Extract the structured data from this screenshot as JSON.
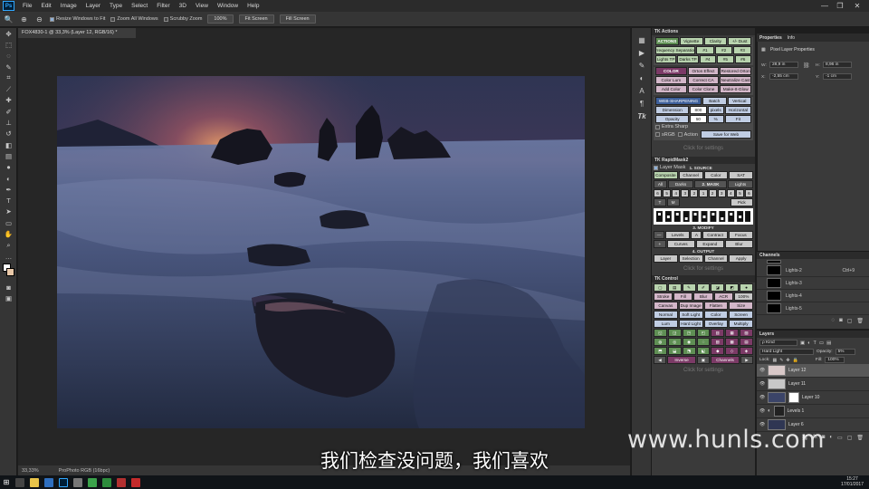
{
  "menubar": {
    "logo": "Ps",
    "items": [
      "File",
      "Edit",
      "Image",
      "Layer",
      "Type",
      "Select",
      "Filter",
      "3D",
      "View",
      "Window",
      "Help"
    ],
    "controls": [
      "—",
      "❐",
      "✕"
    ]
  },
  "options": {
    "resize_windows_label": "Resize Windows to Fit",
    "zoom_all_label": "Zoom All Windows",
    "scrubby_label": "Scrubby Zoom",
    "zoom_value": "100%",
    "fit_screen": "Fit Screen",
    "fill_screen": "Fill Screen"
  },
  "document": {
    "tab_title": "FOX4830-1 @ 33,3% (Layer 12, RGB/16) *",
    "status_zoom": "33,33%",
    "status_profile": "ProPhoto RGB (16bpc)"
  },
  "tk_actions": {
    "title": "TK Actions",
    "actions_row1": [
      "ACTIONS",
      "Vignette",
      "Clarity",
      "+/- Dust"
    ],
    "actions_row2": [
      "Frequency Separation",
      "#1",
      "#2",
      "#3"
    ],
    "actions_row3": [
      "Lights TP",
      "Darks TP",
      "#4",
      "#5",
      "#6"
    ],
    "color_row1": [
      "COLOR",
      "Orton Effect",
      "Restored Orton"
    ],
    "color_row2": [
      "Color Lum",
      "Correct CA",
      "Neutralize Cast"
    ],
    "color_row3": [
      "Add Color",
      "Color Clone",
      "Make-It-Glow"
    ],
    "web_row1": [
      "WEB-SHARPENING",
      "Batch",
      "Vertical"
    ],
    "dimension_label": "Dimension",
    "dimension_value": "800",
    "pixels_label": "pixels",
    "horizontal_label": "Horizontal",
    "opacity_label": "Opacity",
    "opacity_value": "50",
    "percent_label": "%",
    "fit_label": "Fit",
    "extra_sharp_label": "Extra Sharp",
    "srgb_label": "sRGB",
    "action_label": "Action",
    "save_web_label": "Save for Web",
    "click_settings": "Click for settings"
  },
  "tk_rapidmask": {
    "title": "TK RapidMask2",
    "layer_mask": "Layer Mask",
    "source_label": "1. SOURCE",
    "source_buttons": [
      "Composite",
      "Channel",
      "Color",
      "SAT"
    ],
    "mask_row": [
      "All",
      "Darks",
      "2. MASK",
      "Lights"
    ],
    "zones": [
      "6",
      "5",
      "4",
      "3",
      "2",
      "1",
      "2",
      "3",
      "4",
      "5",
      "6"
    ],
    "tm_row": [
      "T",
      "M",
      "Pick"
    ],
    "modify_label": "3. MODIFY",
    "modify_row1": [
      "Levels",
      "A",
      "Contract",
      "Focus"
    ],
    "modify_row2": [
      "Curves",
      "Expand",
      "Blur"
    ],
    "output_label": "4. OUTPUT",
    "output_row": [
      "Layer",
      "Selection",
      "Channel",
      "Apply"
    ],
    "click_settings": "Click for settings"
  },
  "tk_control": {
    "title": "TK Control",
    "row_stroke": [
      "Stroke",
      "Fill",
      "Blur",
      "ACR",
      "100%"
    ],
    "row_canvas": [
      "Canvas",
      "Dup Image",
      "Flatten",
      "Size"
    ],
    "row_blend": [
      "Normal",
      "Soft Light",
      "Color",
      "Screen"
    ],
    "row_lum": [
      "Lum",
      "Hard Light",
      "Overlay",
      "Multiply"
    ],
    "row_inverse": [
      "Inverse",
      "Channels"
    ],
    "click_settings": "Click for settings"
  },
  "properties": {
    "tab1": "Properties",
    "tab2": "Info",
    "subtitle": "Pixel Layer Properties",
    "w_label": "W:",
    "w_value": "28,9 in",
    "h_label": "H:",
    "h_value": "8,96 in",
    "x_label": "X:",
    "x_value": "-2,55 cm",
    "y_label": "Y:",
    "y_value": "-1 cm"
  },
  "channels": {
    "title": "Channels",
    "items": [
      {
        "name": "Lights-2",
        "shortcut": "Ctrl+9"
      },
      {
        "name": "Lights-3",
        "shortcut": ""
      },
      {
        "name": "Lights-4",
        "shortcut": ""
      },
      {
        "name": "Lights-5",
        "shortcut": ""
      }
    ]
  },
  "layers": {
    "title": "Layers",
    "kind_label": "ρ Kind",
    "blend_mode": "Hard Light",
    "opacity_label": "Opacity:",
    "opacity_value": "5%",
    "lock_label": "Lock:",
    "fill_label": "Fill:",
    "fill_value": "100%",
    "items": [
      {
        "name": "Layer 12",
        "selected": true
      },
      {
        "name": "Layer 11",
        "selected": false
      },
      {
        "name": "Layer 10",
        "selected": false
      },
      {
        "name": "Levels 1",
        "selected": false
      },
      {
        "name": "Layer 6",
        "selected": false
      }
    ]
  },
  "overlay": {
    "subtitle": "我们检查没问题，我们喜欢",
    "watermark": "www.hunls.com"
  },
  "taskbar": {
    "time": "15:27",
    "date": "17/01/2017"
  }
}
